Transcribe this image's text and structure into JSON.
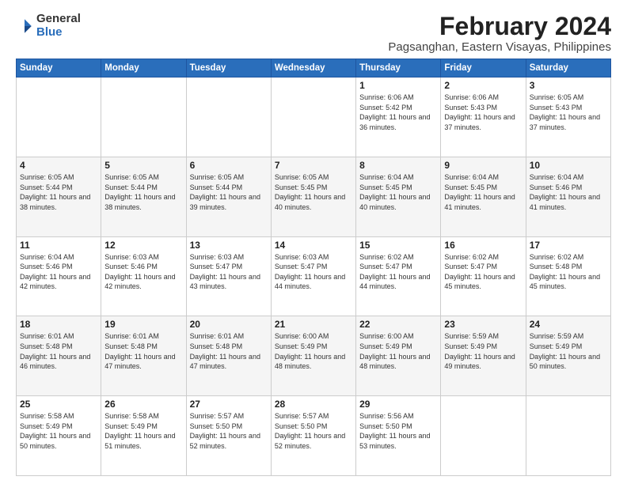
{
  "logo": {
    "general": "General",
    "blue": "Blue"
  },
  "title": "February 2024",
  "subtitle": "Pagsanghan, Eastern Visayas, Philippines",
  "headers": [
    "Sunday",
    "Monday",
    "Tuesday",
    "Wednesday",
    "Thursday",
    "Friday",
    "Saturday"
  ],
  "weeks": [
    [
      {
        "day": "",
        "info": ""
      },
      {
        "day": "",
        "info": ""
      },
      {
        "day": "",
        "info": ""
      },
      {
        "day": "",
        "info": ""
      },
      {
        "day": "1",
        "info": "Sunrise: 6:06 AM\nSunset: 5:42 PM\nDaylight: 11 hours\nand 36 minutes."
      },
      {
        "day": "2",
        "info": "Sunrise: 6:06 AM\nSunset: 5:43 PM\nDaylight: 11 hours\nand 37 minutes."
      },
      {
        "day": "3",
        "info": "Sunrise: 6:05 AM\nSunset: 5:43 PM\nDaylight: 11 hours\nand 37 minutes."
      }
    ],
    [
      {
        "day": "4",
        "info": "Sunrise: 6:05 AM\nSunset: 5:44 PM\nDaylight: 11 hours\nand 38 minutes."
      },
      {
        "day": "5",
        "info": "Sunrise: 6:05 AM\nSunset: 5:44 PM\nDaylight: 11 hours\nand 38 minutes."
      },
      {
        "day": "6",
        "info": "Sunrise: 6:05 AM\nSunset: 5:44 PM\nDaylight: 11 hours\nand 39 minutes."
      },
      {
        "day": "7",
        "info": "Sunrise: 6:05 AM\nSunset: 5:45 PM\nDaylight: 11 hours\nand 40 minutes."
      },
      {
        "day": "8",
        "info": "Sunrise: 6:04 AM\nSunset: 5:45 PM\nDaylight: 11 hours\nand 40 minutes."
      },
      {
        "day": "9",
        "info": "Sunrise: 6:04 AM\nSunset: 5:45 PM\nDaylight: 11 hours\nand 41 minutes."
      },
      {
        "day": "10",
        "info": "Sunrise: 6:04 AM\nSunset: 5:46 PM\nDaylight: 11 hours\nand 41 minutes."
      }
    ],
    [
      {
        "day": "11",
        "info": "Sunrise: 6:04 AM\nSunset: 5:46 PM\nDaylight: 11 hours\nand 42 minutes."
      },
      {
        "day": "12",
        "info": "Sunrise: 6:03 AM\nSunset: 5:46 PM\nDaylight: 11 hours\nand 42 minutes."
      },
      {
        "day": "13",
        "info": "Sunrise: 6:03 AM\nSunset: 5:47 PM\nDaylight: 11 hours\nand 43 minutes."
      },
      {
        "day": "14",
        "info": "Sunrise: 6:03 AM\nSunset: 5:47 PM\nDaylight: 11 hours\nand 44 minutes."
      },
      {
        "day": "15",
        "info": "Sunrise: 6:02 AM\nSunset: 5:47 PM\nDaylight: 11 hours\nand 44 minutes."
      },
      {
        "day": "16",
        "info": "Sunrise: 6:02 AM\nSunset: 5:47 PM\nDaylight: 11 hours\nand 45 minutes."
      },
      {
        "day": "17",
        "info": "Sunrise: 6:02 AM\nSunset: 5:48 PM\nDaylight: 11 hours\nand 45 minutes."
      }
    ],
    [
      {
        "day": "18",
        "info": "Sunrise: 6:01 AM\nSunset: 5:48 PM\nDaylight: 11 hours\nand 46 minutes."
      },
      {
        "day": "19",
        "info": "Sunrise: 6:01 AM\nSunset: 5:48 PM\nDaylight: 11 hours\nand 47 minutes."
      },
      {
        "day": "20",
        "info": "Sunrise: 6:01 AM\nSunset: 5:48 PM\nDaylight: 11 hours\nand 47 minutes."
      },
      {
        "day": "21",
        "info": "Sunrise: 6:00 AM\nSunset: 5:49 PM\nDaylight: 11 hours\nand 48 minutes."
      },
      {
        "day": "22",
        "info": "Sunrise: 6:00 AM\nSunset: 5:49 PM\nDaylight: 11 hours\nand 48 minutes."
      },
      {
        "day": "23",
        "info": "Sunrise: 5:59 AM\nSunset: 5:49 PM\nDaylight: 11 hours\nand 49 minutes."
      },
      {
        "day": "24",
        "info": "Sunrise: 5:59 AM\nSunset: 5:49 PM\nDaylight: 11 hours\nand 50 minutes."
      }
    ],
    [
      {
        "day": "25",
        "info": "Sunrise: 5:58 AM\nSunset: 5:49 PM\nDaylight: 11 hours\nand 50 minutes."
      },
      {
        "day": "26",
        "info": "Sunrise: 5:58 AM\nSunset: 5:49 PM\nDaylight: 11 hours\nand 51 minutes."
      },
      {
        "day": "27",
        "info": "Sunrise: 5:57 AM\nSunset: 5:50 PM\nDaylight: 11 hours\nand 52 minutes."
      },
      {
        "day": "28",
        "info": "Sunrise: 5:57 AM\nSunset: 5:50 PM\nDaylight: 11 hours\nand 52 minutes."
      },
      {
        "day": "29",
        "info": "Sunrise: 5:56 AM\nSunset: 5:50 PM\nDaylight: 11 hours\nand 53 minutes."
      },
      {
        "day": "",
        "info": ""
      },
      {
        "day": "",
        "info": ""
      }
    ]
  ]
}
